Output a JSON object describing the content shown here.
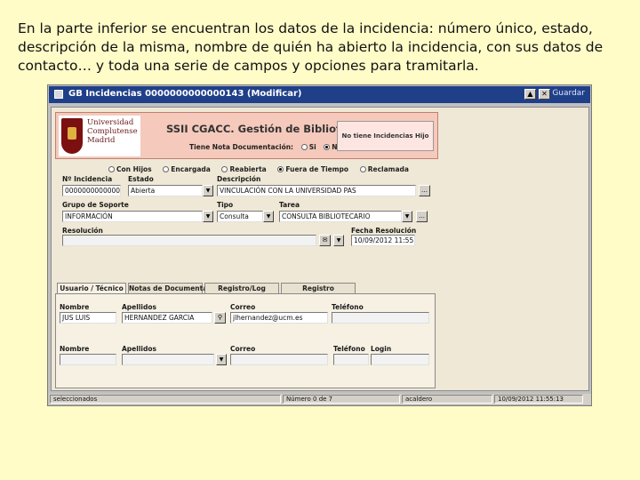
{
  "caption": "En la parte inferior se encuentran los datos de la incidencia: número único, estado, descripción de la misma, nombre de quién ha abierto la incidencia, con sus datos de contacto… y toda una serie de campos y opciones para tramitarla.",
  "window": {
    "title": "GB Incidencias 0000000000000143 (Modificar)",
    "toolbar_extra": "Guardar"
  },
  "banner": {
    "university": [
      "Universidad",
      "Complutense",
      "Madrid"
    ],
    "system_title": "SSII CGACC. Gestión de Biblioteca",
    "nota_label": "Tiene Nota Documentación:",
    "nota_si": "Si",
    "nota_no": "No",
    "hijos": "No tiene Incidencias Hijo"
  },
  "filters": [
    "Con Hijos",
    "Encargada",
    "Reabierta",
    "Fuera de Tiempo",
    "Reclamada"
  ],
  "fields": {
    "num_label": "Nº Incidencia",
    "num_value": "0000000000000143",
    "estado_label": "Estado",
    "estado_value": "Abierta",
    "descripcion_label": "Descripción",
    "descripcion_value": "VINCULACIÓN CON LA UNIVERSIDAD PAS",
    "grupo_label": "Grupo de Soporte",
    "grupo_value": "INFORMACIÓN",
    "tipo_label": "Tipo",
    "tipo_value": "Consulta",
    "tarea_label": "Tarea",
    "tarea_value": "CONSULTA BIBLIOTECARIO",
    "resolucion_label": "Resolución",
    "fecha_label": "Fecha Resolución",
    "fecha_value": "10/09/2012 11:55:13"
  },
  "tabs": [
    "Usuario / Técnico",
    "Notas de Documentación",
    "Registro/Log",
    "Registro"
  ],
  "contact": {
    "nombre_label": "Nombre",
    "apellidos_label": "Apellidos",
    "correo_label": "Correo",
    "telefono_label": "Teléfono",
    "login_label": "Login",
    "nombre_value": "JUS LUIS",
    "apellidos_value": "HERNANDEZ GARCIA",
    "correo_value": "jlhernandez@ucm.es"
  },
  "status": {
    "seleccionados": "seleccionados",
    "registro": "Número 0 de 7",
    "usuario": "acaldero",
    "fecha": "10/09/2012 11:55:13"
  }
}
